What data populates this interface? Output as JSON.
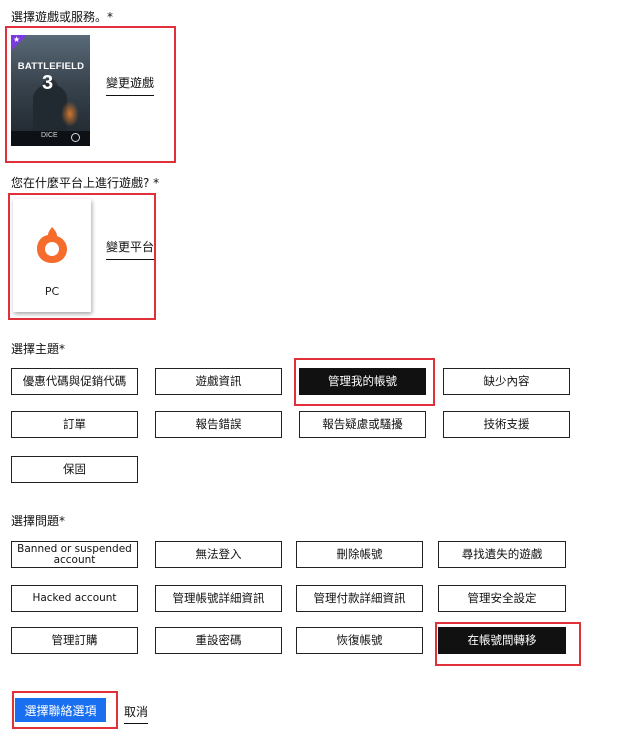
{
  "game_section": {
    "label": "選擇遊戲或服務。*",
    "game": {
      "title": "BATTLEFIELD",
      "number": "3",
      "developer": "DICE",
      "publisher_icon": "ea-logo",
      "badge_icon": "star-icon"
    },
    "change_link": "變更遊戲"
  },
  "platform_section": {
    "label": "您在什麼平台上進行遊戲? *",
    "platform": {
      "icon": "origin-logo",
      "name": "PC"
    },
    "change_link": "變更平台"
  },
  "topic_section": {
    "label": "選擇主題*",
    "options": [
      "優惠代碼與促銷代碼",
      "遊戲資訊",
      "管理我的帳號",
      "缺少內容",
      "訂單",
      "報告錯誤",
      "報告疑慮或騷擾",
      "技術支援",
      "保固"
    ],
    "selected": "管理我的帳號"
  },
  "issue_section": {
    "label": "選擇問題*",
    "options": [
      "Banned or suspended account",
      "無法登入",
      "刪除帳號",
      "尋找遺失的遊戲",
      "Hacked account",
      "管理帳號詳細資訊",
      "管理付款詳細資訊",
      "管理安全設定",
      "管理訂購",
      "重設密碼",
      "恢復帳號",
      "在帳號間轉移"
    ],
    "selected": "在帳號間轉移"
  },
  "actions": {
    "primary": "選擇聯絡選項",
    "cancel": "取消"
  },
  "colors": {
    "accent": "#1a6ff0",
    "selected_bg": "#111111",
    "highlight": "#e0303a",
    "badge": "#7b3ae0",
    "origin": "#f56c2d"
  }
}
